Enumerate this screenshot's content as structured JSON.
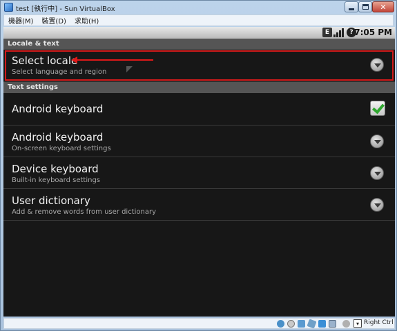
{
  "window": {
    "title": "test [執行中] - Sun VirtualBox",
    "minimize_label": "_",
    "close_label": "✕"
  },
  "menubar": {
    "items": [
      "機器(M)",
      "裝置(D)",
      "求助(H)"
    ]
  },
  "android_status": {
    "network_badge": "E",
    "alarm_badge": "?",
    "time": "7:05 PM"
  },
  "sections": {
    "locale_header": "Locale & text",
    "text_header": "Text settings"
  },
  "rows": [
    {
      "title": "Select locale",
      "summary": "Select language and region",
      "widget": "chevron"
    },
    {
      "title": "Android keyboard",
      "summary": "",
      "widget": "checkbox",
      "checked": true
    },
    {
      "title": "Android keyboard",
      "summary": "On-screen keyboard settings",
      "widget": "chevron"
    },
    {
      "title": "Device keyboard",
      "summary": "Built-in keyboard settings",
      "widget": "chevron"
    },
    {
      "title": "User dictionary",
      "summary": "Add & remove words from user dictionary",
      "widget": "chevron"
    }
  ],
  "vbox_status": {
    "host_key_label": "Right Ctrl",
    "icons": [
      "harddisk-icon",
      "cdrom-icon",
      "network-icon",
      "usb-icon",
      "shared-folder-icon",
      "display-icon",
      "mouse-integration-icon",
      "host-key-icon"
    ]
  },
  "colors": {
    "highlight": "#d21a1a",
    "check": "#2fa72f"
  }
}
